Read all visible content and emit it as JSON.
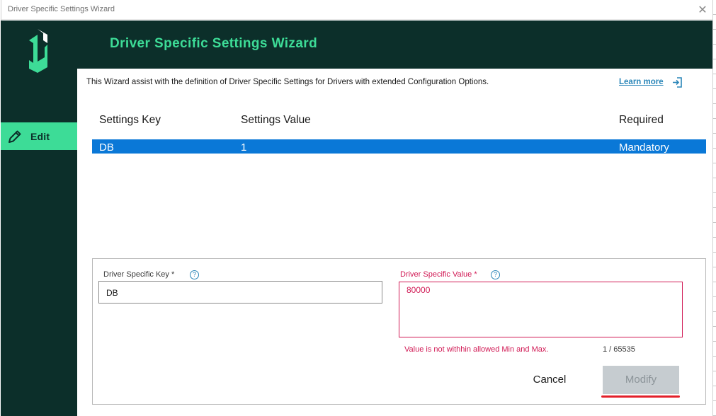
{
  "window": {
    "title": "Driver Specific Settings Wizard",
    "close_glyph": "✕"
  },
  "header": {
    "title": "Driver Specific Settings Wizard"
  },
  "sidebar": {
    "items": [
      {
        "label": "Edit",
        "icon": "pencil-icon"
      }
    ]
  },
  "main": {
    "description": "This Wizard assist with the definition of Driver Specific Settings for Drivers with extended Configuration Options.",
    "learn_more": "Learn more",
    "table": {
      "columns": [
        "Settings Key",
        "Settings Value",
        "Required"
      ],
      "rows": [
        [
          "DB",
          "1",
          "Mandatory"
        ]
      ]
    }
  },
  "form": {
    "key_label": "Driver Specific Key *",
    "key_value": "DB",
    "value_label": "Driver Specific Value *",
    "value_value": "80000",
    "help_glyph": "?",
    "error": "Value is not withhin allowed Min and Max.",
    "counter": "1 / 65535",
    "cancel": "Cancel",
    "modify": "Modify"
  },
  "colors": {
    "dark_green": "#0c2f2a",
    "accent_green": "#3ddc97",
    "selection_blue": "#0a78d7",
    "error_red": "#d11a55",
    "link_blue": "#2a86b8"
  }
}
